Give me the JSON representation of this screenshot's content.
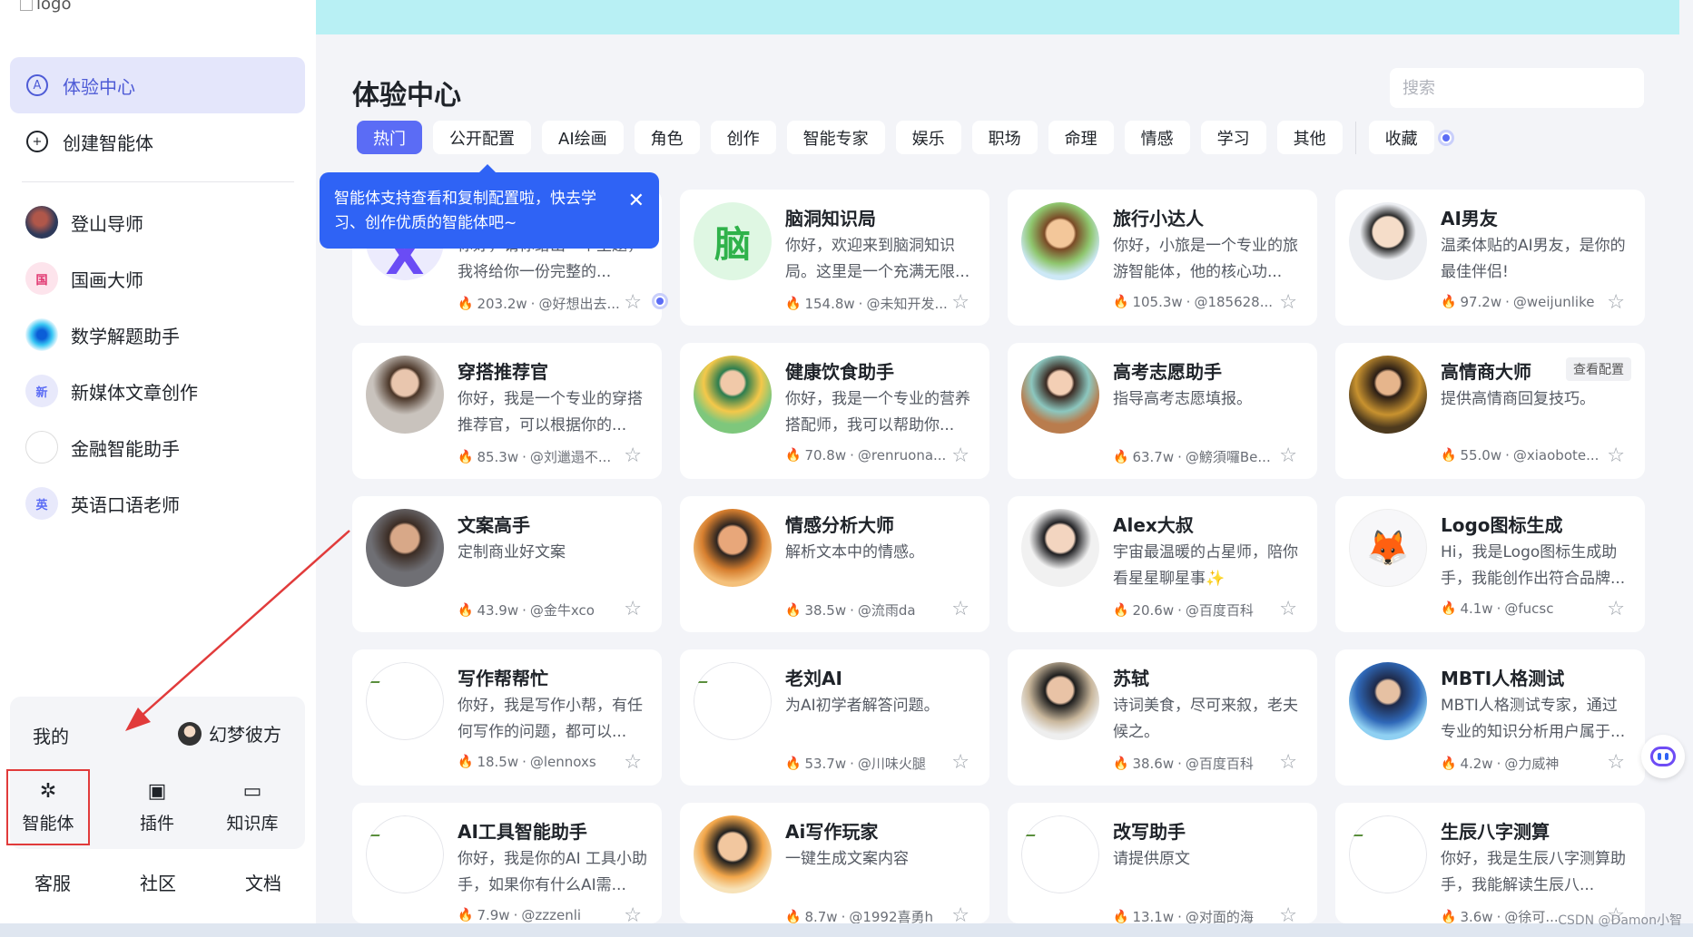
{
  "logo_alt": "logo",
  "sidebar": {
    "nav": [
      {
        "label": "体验中心",
        "icon": "A"
      },
      {
        "label": "创建智能体",
        "icon": "+"
      }
    ],
    "recent": [
      {
        "label": "登山导师",
        "badge": ""
      },
      {
        "label": "国画大师",
        "badge": "国"
      },
      {
        "label": "数学解题助手",
        "badge": ""
      },
      {
        "label": "新媒体文章创作",
        "badge": "新"
      },
      {
        "label": "金融智能助手",
        "badge": ""
      },
      {
        "label": "英语口语老师",
        "badge": "英"
      }
    ],
    "my_label": "我的",
    "username": "幻梦彼方",
    "tools": [
      {
        "label": "智能体",
        "icon": "✲"
      },
      {
        "label": "插件",
        "icon": "▣"
      },
      {
        "label": "知识库",
        "icon": "▭"
      }
    ],
    "footer": [
      "客服",
      "社区",
      "文档"
    ]
  },
  "main": {
    "title": "体验中心",
    "search_placeholder": "搜索",
    "tabs": [
      "热门",
      "公开配置",
      "AI绘画",
      "角色",
      "创作",
      "智能专家",
      "娱乐",
      "职场",
      "命理",
      "情感",
      "学习",
      "其他"
    ],
    "fav_tab": "收藏",
    "tooltip": "智能体支持查看和复制配置啦，快去学习、创作优质的智能体吧~",
    "config_label": "查看配置",
    "cards": [
      {
        "title": "",
        "desc": "你好，请你给出一个主题，我将给你一份完整的...",
        "count": "203.2w",
        "author": "@好想出去..."
      },
      {
        "title": "脑洞知识局",
        "desc": "你好，欢迎来到脑洞知识局。这里是一个充满无限...",
        "count": "154.8w",
        "author": "@未知开发...",
        "glyph": "脑"
      },
      {
        "title": "旅行小达人",
        "desc": "你好，小旅是一个专业的旅游智能体，他的核心功...",
        "count": "105.3w",
        "author": "@185628..."
      },
      {
        "title": "AI男友",
        "desc": "温柔体贴的AI男友，是你的最佳伴侣!",
        "count": "97.2w",
        "author": "@weijunlike"
      },
      {
        "title": "穿搭推荐官",
        "desc": "你好，我是一个专业的穿搭推荐官，可以根据你的...",
        "count": "85.3w",
        "author": "@刘邋遢不..."
      },
      {
        "title": "健康饮食助手",
        "desc": "你好，我是一个专业的营养搭配师，我可以帮助你...",
        "count": "70.8w",
        "author": "@renruona..."
      },
      {
        "title": "高考志愿助手",
        "desc": "指导高考志愿填报。",
        "count": "63.7w",
        "author": "@鰟須囉Be..."
      },
      {
        "title": "高情商大师",
        "desc": "提供高情商回复技巧。",
        "count": "55.0w",
        "author": "@xiaobote..."
      },
      {
        "title": "文案高手",
        "desc": "定制商业好文案",
        "count": "43.9w",
        "author": "@金牛xco"
      },
      {
        "title": "情感分析大师",
        "desc": "解析文本中的情感。",
        "count": "38.5w",
        "author": "@流雨da"
      },
      {
        "title": "Alex大叔",
        "desc": "宇宙最温暖的占星师，陪你看星星聊星事✨",
        "count": "20.6w",
        "author": "@百度百科"
      },
      {
        "title": "Logo图标生成",
        "desc": "Hi，我是Logo图标生成助手，我能创作出符合品牌...",
        "count": "4.1w",
        "author": "@fucsc"
      },
      {
        "title": "写作帮帮忙",
        "desc": "你好，我是写作小帮，有任何写作的问题，都可以...",
        "count": "18.5w",
        "author": "@lennoxs"
      },
      {
        "title": "老刘AI",
        "desc": "为AI初学者解答问题。",
        "count": "53.7w",
        "author": "@川味火腿"
      },
      {
        "title": "苏轼",
        "desc": "诗词美食，尽可来叙，老夫候之。",
        "count": "38.6w",
        "author": "@百度百科"
      },
      {
        "title": "MBTI人格测试",
        "desc": "MBTI人格测试专家，通过专业的知识分析用户属于...",
        "count": "4.2w",
        "author": "@力威神"
      },
      {
        "title": "AI工具智能助手",
        "desc": "你好，我是你的AI 工具小助手，如果你有什么AI需...",
        "count": "7.9w",
        "author": "@zzzenli"
      },
      {
        "title": "Ai写作玩家",
        "desc": "一键生成文案内容",
        "count": "8.7w",
        "author": "@1992喜勇h"
      },
      {
        "title": "改写助手",
        "desc": "请提供原文",
        "count": "13.1w",
        "author": "@对面的海"
      },
      {
        "title": "生辰八字测算",
        "desc": "你好，我是生辰八字测算助手，我能解读生辰八...",
        "count": "3.6w",
        "author": "@徐可..."
      }
    ]
  },
  "watermark": "CSDN @Damon小智"
}
